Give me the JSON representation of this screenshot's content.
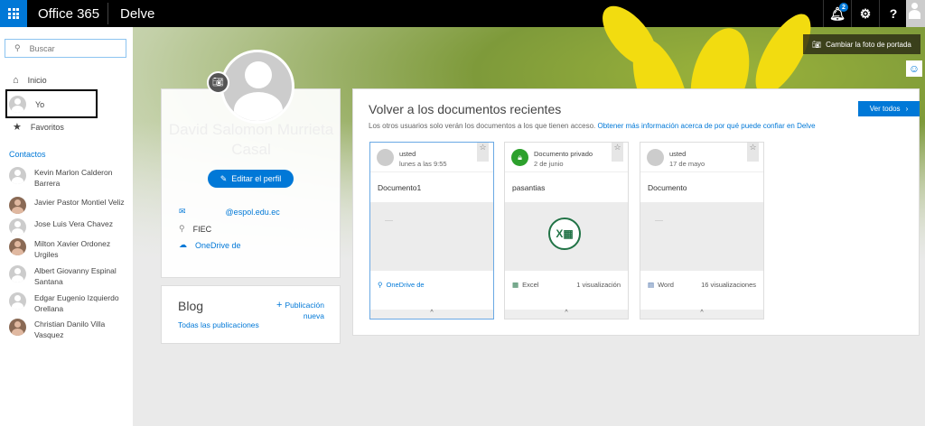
{
  "topbar": {
    "brand": "Office 365",
    "app": "Delve",
    "notification_count": "2",
    "settings_icon": "⚙",
    "help_icon": "?"
  },
  "sidebar": {
    "search_placeholder": "Buscar",
    "nav": [
      {
        "label": "Inicio"
      },
      {
        "label": "Yo"
      },
      {
        "label": "Favoritos"
      }
    ],
    "contacts_title": "Contactos",
    "contacts": [
      "Kevin Marlon Calderon Barrera",
      "Javier Pastor Montiel Veliz",
      "Jose Luis Vera Chavez",
      "Milton Xavier Ordonez Urgiles",
      "Albert Giovanny Espinal Santana",
      "Edgar Eugenio Izquierdo Orellana",
      "Christian Danilo Villa Vasquez"
    ]
  },
  "cover": {
    "change_photo": "Cambiar la foto de portada"
  },
  "profile": {
    "name": "David Salomon Murrieta Casal",
    "edit": "Editar el perfil",
    "email": "@espol.edu.ec",
    "location": "FIEC",
    "onedrive": "OneDrive de"
  },
  "blog": {
    "title": "Blog",
    "new_post": "Publicación nueva",
    "all_posts": "Todas las publicaciones"
  },
  "recent": {
    "title": "Volver a los documentos recientes",
    "subtitle": "Los otros usuarios solo verán los documentos a los que tienen acceso.",
    "link": "Obtener más información acerca de por qué puede confiar en Delve",
    "view_all": "Ver todos",
    "docs": [
      {
        "author": "usted",
        "date": "lunes a las 9:55",
        "title": "Documento1",
        "source": "OneDrive de",
        "views": ""
      },
      {
        "author": "Documento privado",
        "date": "2 de junio",
        "title": "pasantias",
        "source": "Excel",
        "views": "1 visualización"
      },
      {
        "author": "usted",
        "date": "17 de mayo",
        "title": "Documento",
        "source": "Word",
        "views": "16 visualizaciones"
      }
    ]
  }
}
